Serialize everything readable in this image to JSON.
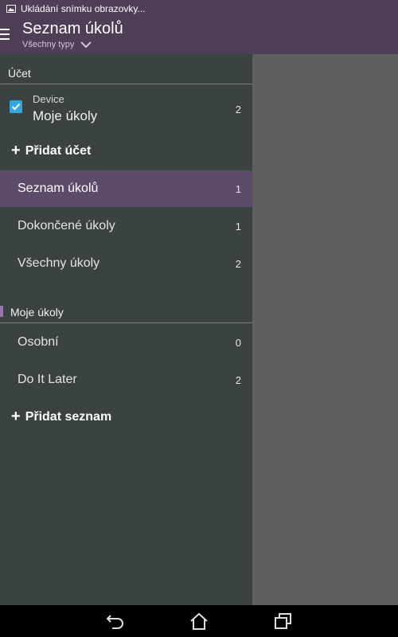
{
  "status_bar": {
    "notification": "Ukládání snímku obrazovky..."
  },
  "app_bar": {
    "title": "Seznam úkolů",
    "subtitle": "Všechny typy"
  },
  "drawer": {
    "account_section": "Účet",
    "account": {
      "type": "Device",
      "name": "Moje úkoly",
      "count": "2",
      "checked": true
    },
    "add_account": "Přidat účet",
    "filters": [
      {
        "label": "Seznam úkolů",
        "count": "1",
        "active": true
      },
      {
        "label": "Dokončené úkoly",
        "count": "1",
        "active": false
      },
      {
        "label": "Všechny úkoly",
        "count": "2",
        "active": false
      }
    ],
    "lists_section": "Moje úkoly",
    "lists": [
      {
        "label": "Osobní",
        "count": "0"
      },
      {
        "label": "Do It Later",
        "count": "2"
      }
    ],
    "add_list": "Přidat seznam"
  },
  "colors": {
    "accent": "#4e3e56",
    "active_row": "#5c4c6a",
    "drawer_bg": "#3b4242",
    "checkbox": "#33a6dd",
    "list_marker": "#9c74ad"
  },
  "nav_icons": [
    "back-icon",
    "home-icon",
    "recent-apps-icon"
  ]
}
